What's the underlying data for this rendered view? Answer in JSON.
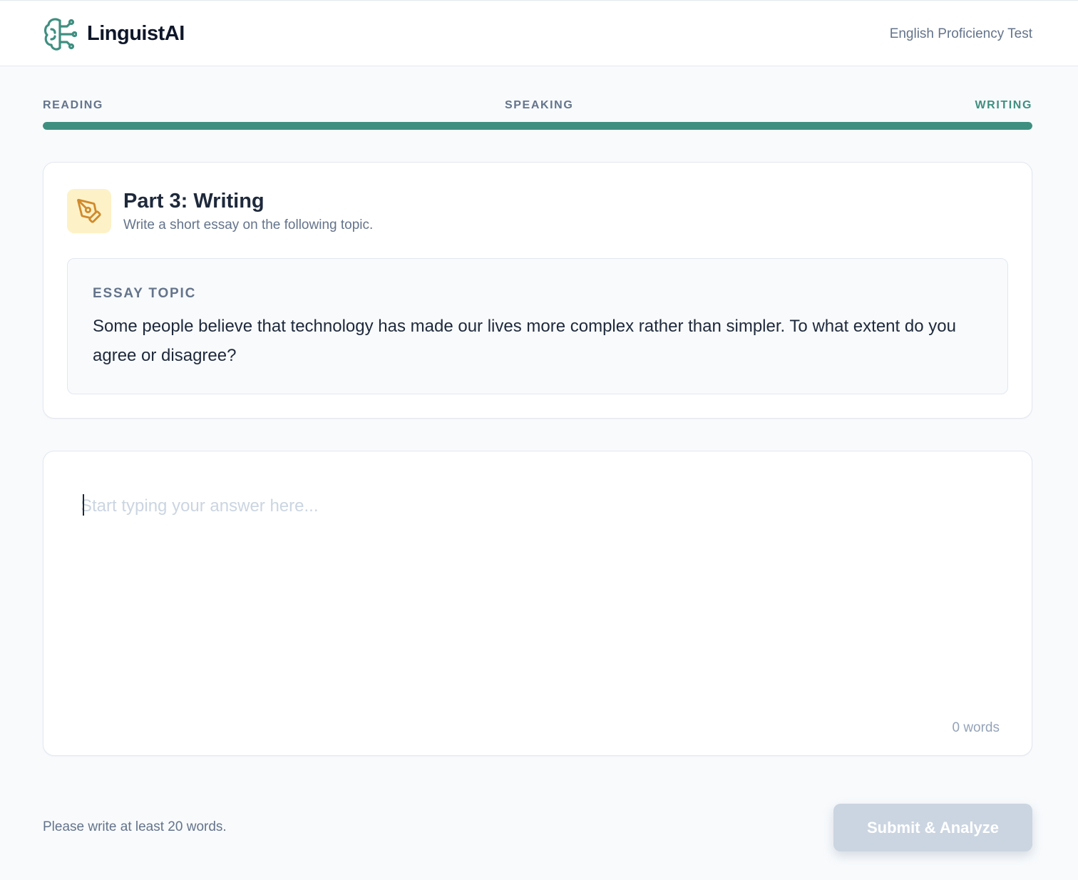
{
  "header": {
    "brand": "LinguistAI",
    "test_name": "English Proficiency Test",
    "logo_icon": "brain-circuit-icon"
  },
  "steps": [
    {
      "label": "READING"
    },
    {
      "label": "SPEAKING"
    },
    {
      "label": "WRITING",
      "active": true
    }
  ],
  "progress": {
    "percent": 100,
    "color": "#3f8f80"
  },
  "section": {
    "icon": "pen-tool-icon",
    "title": "Part 3: Writing",
    "subtitle": "Write a short essay on the following topic."
  },
  "topic": {
    "label": "ESSAY TOPIC",
    "text": "Some people believe that technology has made our lives more complex rather than simpler. To what extent do you agree or disagree?"
  },
  "answer": {
    "value": "",
    "placeholder": "Start typing your answer here...",
    "word_count": "0 words"
  },
  "footer": {
    "hint": "Please write at least 20 words.",
    "submit_label": "Submit & Analyze"
  },
  "colors": {
    "accent": "#3f8f80",
    "icon_bg": "#fdf1c7",
    "icon_stroke": "#d08a2c",
    "disabled_button": "#cbd5e1"
  }
}
